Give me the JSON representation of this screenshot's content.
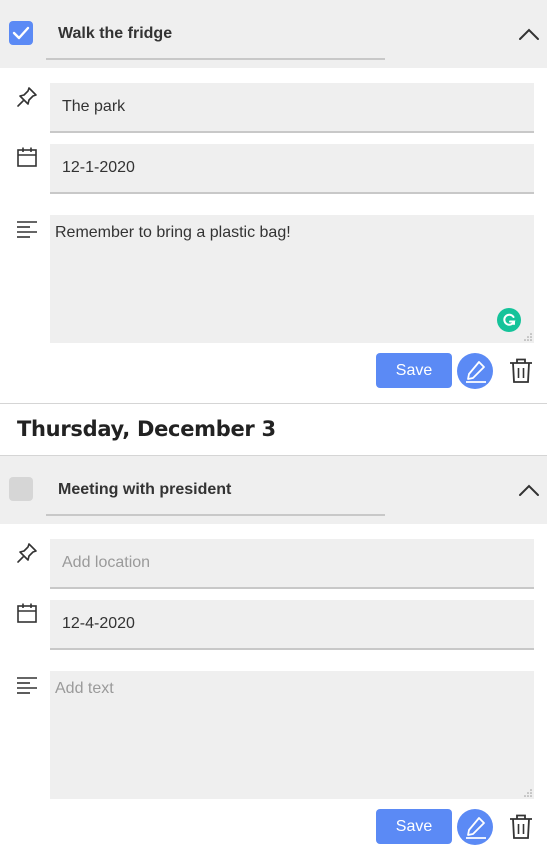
{
  "tasks": [
    {
      "checked": true,
      "title": "Walk the fridge",
      "location": "The park",
      "location_placeholder": "Add location",
      "date": "12-1-2020",
      "notes": "Remember to bring a plastic bag!",
      "notes_placeholder": "Add text",
      "save_label": "Save"
    },
    {
      "checked": false,
      "title": "Meeting with president",
      "location": "",
      "location_placeholder": "Add location",
      "date": "12-4-2020",
      "notes": "",
      "notes_placeholder": "Add text",
      "save_label": "Save"
    }
  ],
  "day_heading": "Thursday, December 3",
  "icons": {
    "location": "pin-icon",
    "date": "calendar-icon",
    "notes": "text-lines-icon",
    "expand": "chevron-up-icon",
    "edit": "pencil-icon",
    "delete": "trash-icon",
    "grammarly": "grammarly-icon"
  },
  "colors": {
    "accent": "#5b8af5",
    "panel": "#efefef",
    "grammarly": "#15c39a"
  }
}
